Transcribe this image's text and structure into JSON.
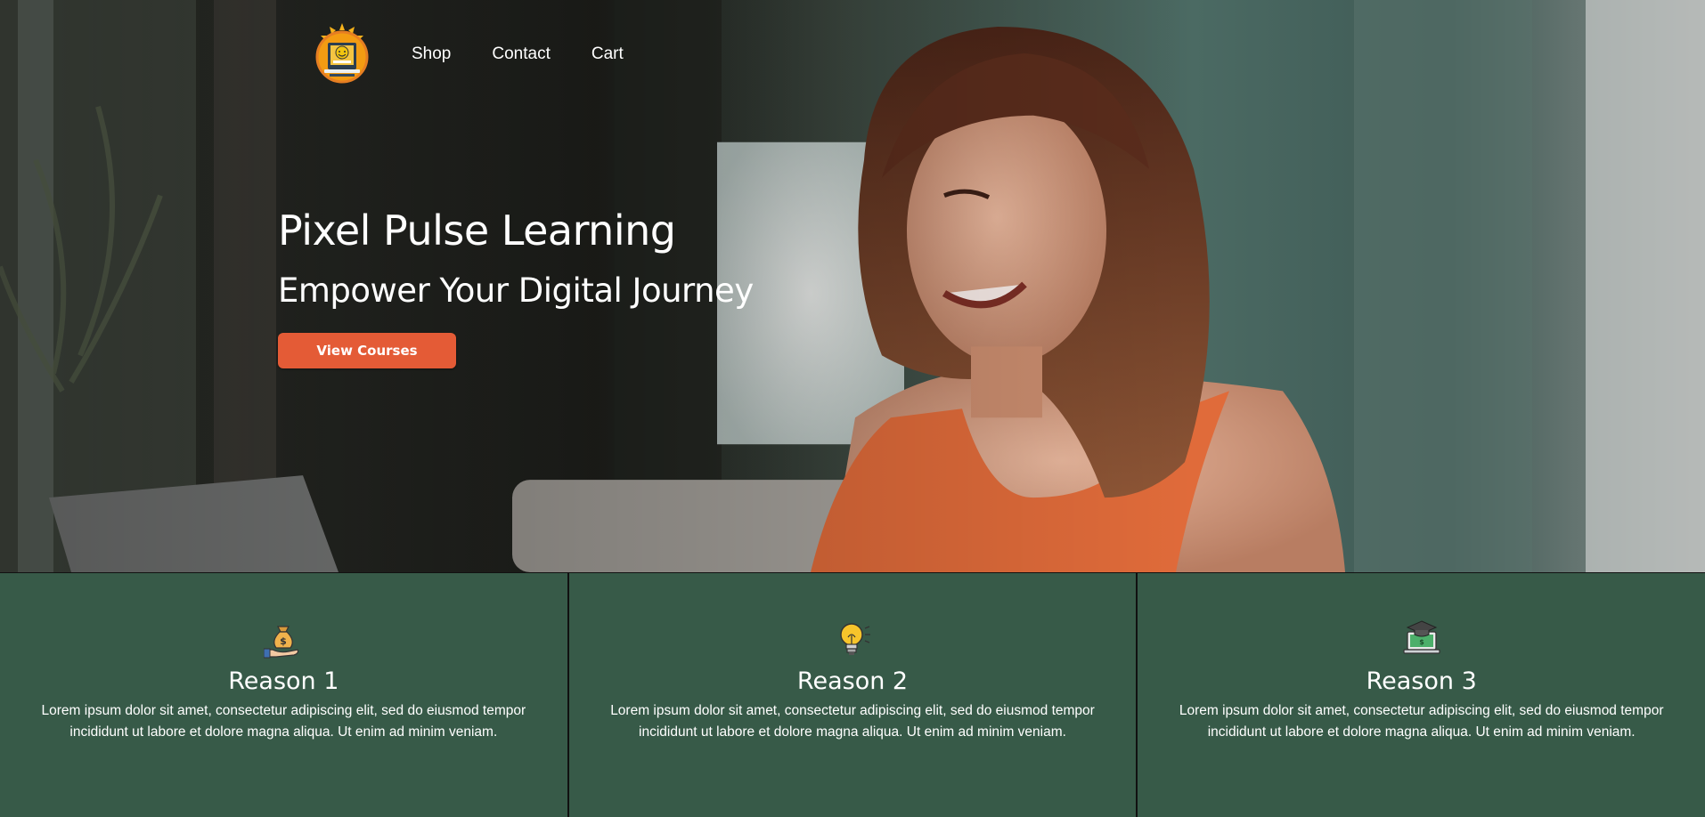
{
  "nav": {
    "logo": "smiling-sun-laptop-logo",
    "links": [
      "Shop",
      "Contact",
      "Cart"
    ]
  },
  "hero": {
    "title": "Pixel Pulse Learning",
    "subtitle": "Empower Your Digital Journey",
    "cta_label": "View Courses"
  },
  "reasons": [
    {
      "icon": "money-bag-hand-icon",
      "title": "Reason 1",
      "text": "Lorem ipsum dolor sit amet, consectetur adipiscing elit, sed do eiusmod tempor incididunt ut labore et dolore magna aliqua. Ut enim ad minim veniam."
    },
    {
      "icon": "lightbulb-icon",
      "title": "Reason 2",
      "text": "Lorem ipsum dolor sit amet, consectetur adipiscing elit, sed do eiusmod tempor incididunt ut labore et dolore magna aliqua. Ut enim ad minim veniam."
    },
    {
      "icon": "graduation-laptop-icon",
      "title": "Reason 3",
      "text": "Lorem ipsum dolor sit amet, consectetur adipiscing elit, sed do eiusmod tempor incididunt ut labore et dolore magna aliqua. Ut enim ad minim veniam."
    }
  ],
  "colors": {
    "accent": "#e45b36",
    "reasons_bg": "#375a48"
  }
}
